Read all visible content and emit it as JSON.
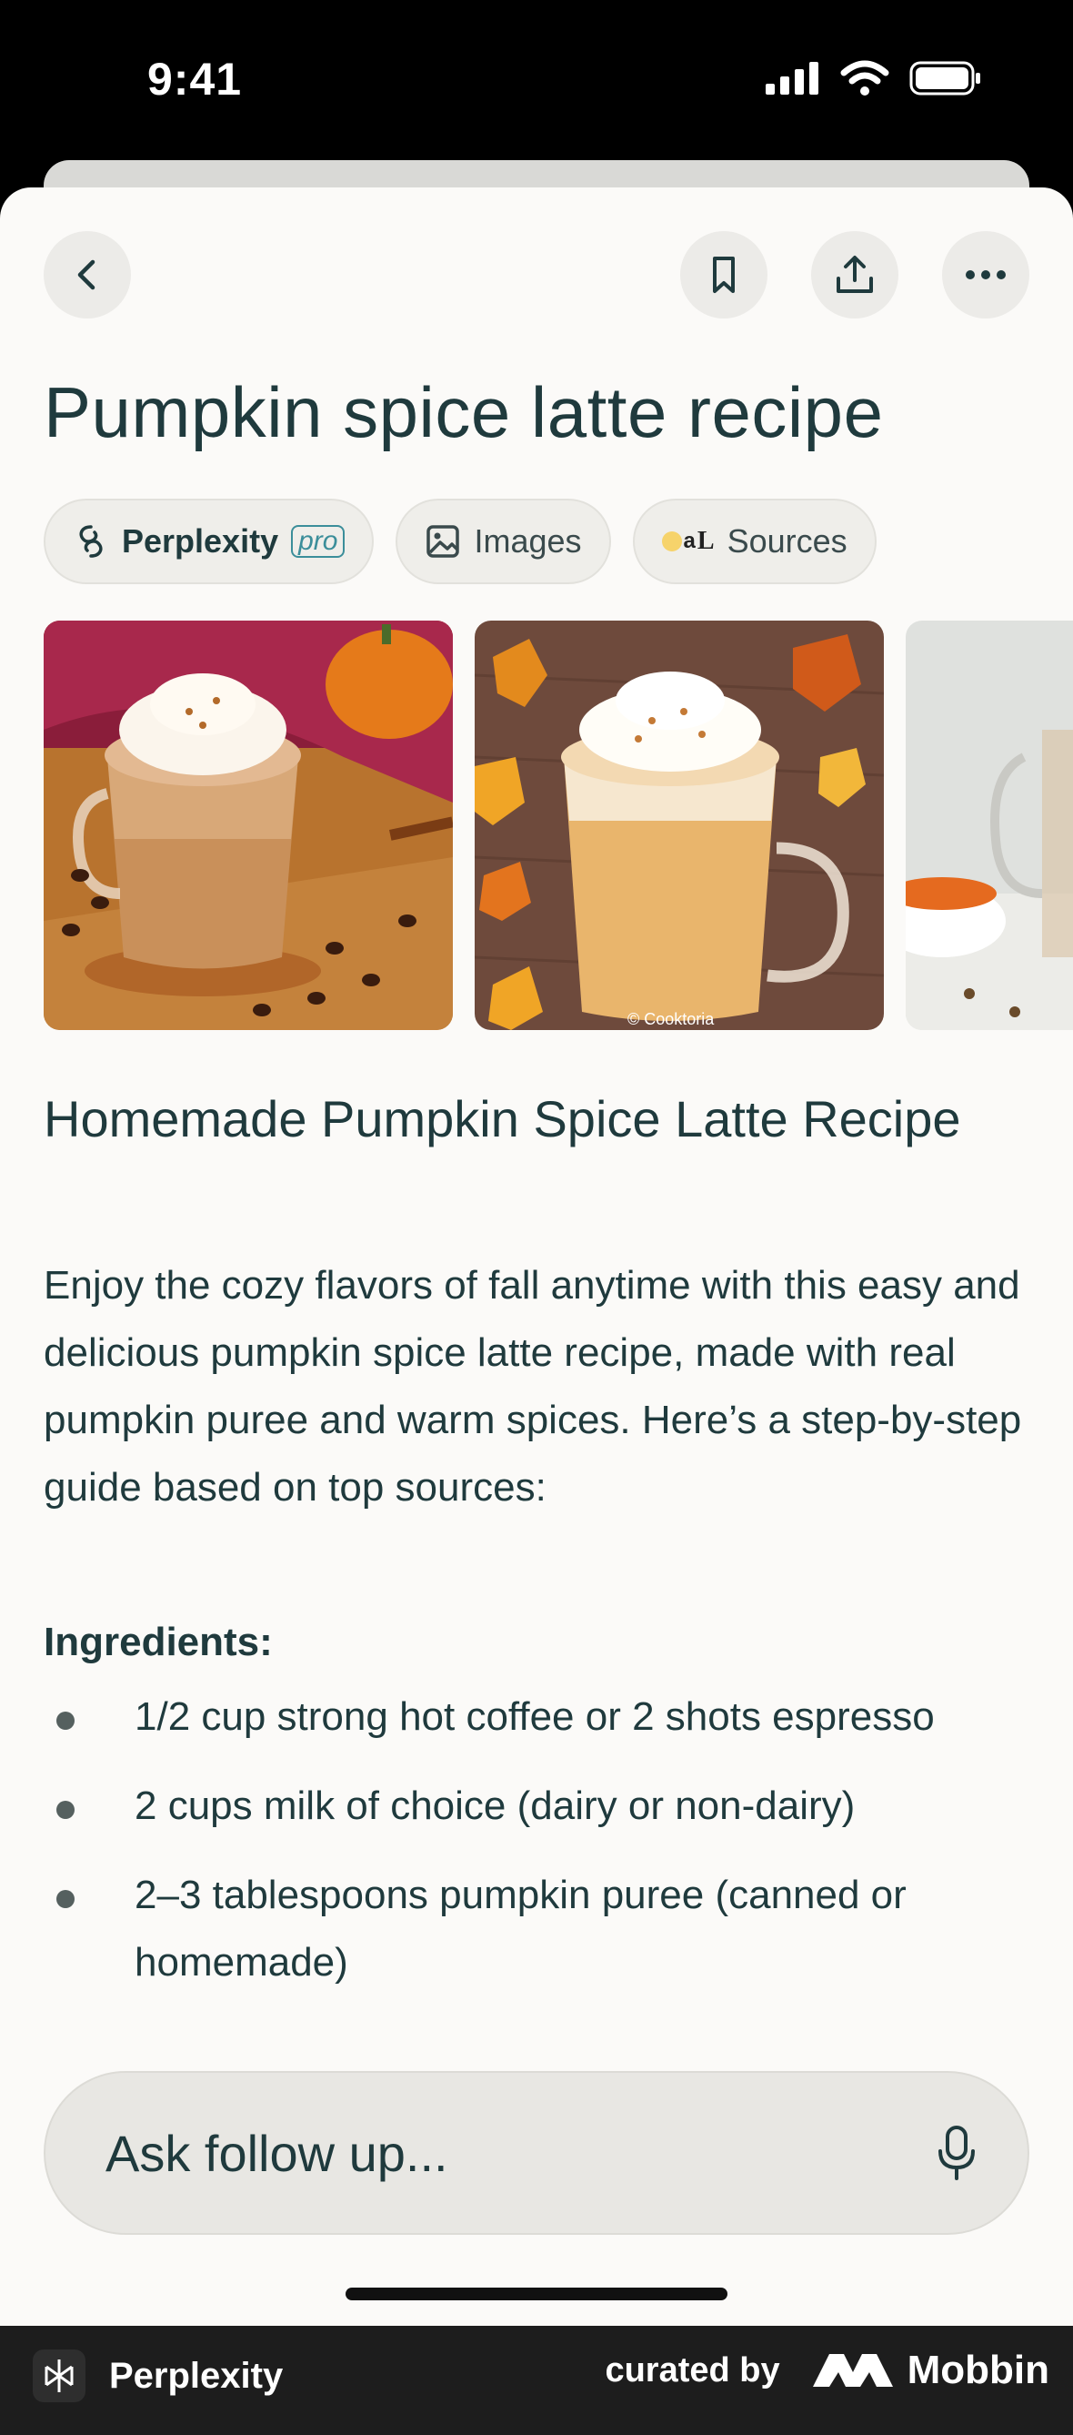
{
  "status_bar": {
    "time": "9:41"
  },
  "header": {
    "title": "Pumpkin spice latte recipe",
    "icons": {
      "back": "chevron-left-icon",
      "bookmark": "bookmark-icon",
      "share": "share-icon",
      "more": "more-icon"
    }
  },
  "chips": [
    {
      "label": "Perplexity",
      "badge": "pro",
      "icon": "perplexity-logo-icon"
    },
    {
      "label": "Images",
      "icon": "image-icon"
    },
    {
      "label": "Sources",
      "icon": "source-favicons-icon",
      "favicon_letters": [
        "a",
        "L"
      ]
    }
  ],
  "images": [
    {
      "alt": "pumpkin-latte-mug-red-napkin",
      "watermark": ""
    },
    {
      "alt": "pumpkin-latte-autumn-leaves",
      "watermark": "© Cooktoria"
    },
    {
      "alt": "pumpkin-latte-glass-partial",
      "watermark": ""
    }
  ],
  "answer": {
    "heading": "Homemade Pumpkin Spice Latte Recipe",
    "intro": "Enjoy the cozy flavors of fall anytime with this easy and delicious pumpkin spice latte recipe, made with real pumpkin puree and warm spices. Here’s a step-by-step guide based on top sources:",
    "ingredients_title": "Ingredients:",
    "ingredients": [
      "1/2 cup strong hot coffee or 2 shots espresso",
      "2 cups milk of choice (dairy or non-dairy)",
      "2–3 tablespoons pumpkin puree (canned or homemade)"
    ]
  },
  "ask_bar": {
    "placeholder": "Ask follow up...",
    "mic_icon": "microphone-icon"
  },
  "footer": {
    "app_name": "Perplexity",
    "curated_by": "curated by",
    "brand": "Mobbin"
  },
  "colors": {
    "text": "#1f3a3d",
    "accent": "#3b8e9a",
    "sheet_bg": "#fbfaf8",
    "chip_bg": "#efeeea"
  }
}
